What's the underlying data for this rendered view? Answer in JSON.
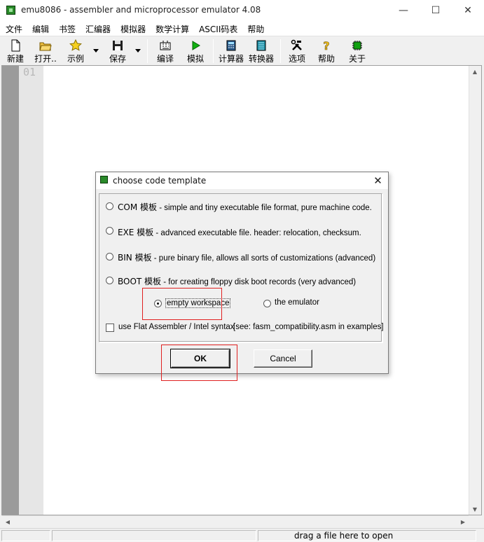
{
  "window": {
    "title": "emu8086 - assembler and microprocessor emulator 4.08",
    "minimize": "—",
    "maximize": "☐",
    "close": "✕"
  },
  "menu": [
    "文件",
    "编辑",
    "书签",
    "汇编器",
    "模拟器",
    "数学计算",
    "ASCII码表",
    "帮助"
  ],
  "toolbar": {
    "new": "新建",
    "open": "打开..",
    "examples": "示例",
    "save": "保存",
    "compile": "编译",
    "emulate": "模拟",
    "calculator": "计算器",
    "converter": "转换器",
    "options": "选项",
    "help": "帮助",
    "about": "关于"
  },
  "editor": {
    "line_number": "01"
  },
  "status": {
    "hint": "drag a file here to open"
  },
  "dialog": {
    "title": "choose code template",
    "close": "✕",
    "options": [
      {
        "kw": "COM 模板",
        "desc": " - simple and tiny executable file format, pure machine code."
      },
      {
        "kw": "EXE 模板",
        "desc": " - advanced executable file. header: relocation, checksum."
      },
      {
        "kw": "BIN 模板",
        "desc": " - pure binary file, allows all sorts of customizations (advanced)"
      },
      {
        "kw": "BOOT 模板",
        "desc": " - for creating floppy disk boot records (very advanced)"
      }
    ],
    "empty_workspace": "empty workspace",
    "the_emulator": "the emulator",
    "fasm_label": "use Flat Assembler / Intel syntax",
    "fasm_note": "[see: fasm_compatibility.asm in examples]",
    "ok": "OK",
    "cancel": "Cancel"
  },
  "colors": {
    "highlight": "#e02020",
    "gutter": "#9b9b9b",
    "gutter_numbers": "#e6e6e6"
  }
}
